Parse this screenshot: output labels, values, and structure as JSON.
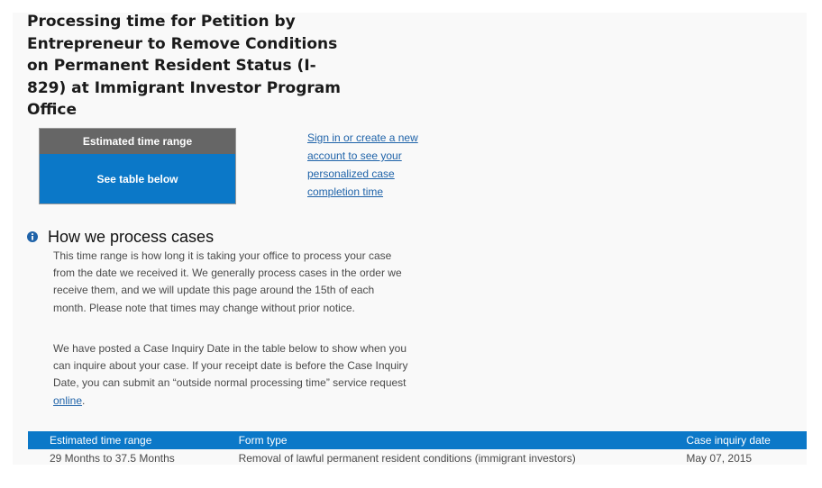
{
  "title": "Processing time for Petition by Entrepreneur to Remove Conditions on Permanent Resident Status (I-829) at Immigrant Investor Program Office",
  "estimate_box": {
    "header": "Estimated time range",
    "value": "See table below"
  },
  "signin_link": "Sign in or create a new account to see your personalized case completion time",
  "how_section": {
    "icon": "info-icon",
    "heading": "How we process cases",
    "paragraph_1": "This time range is how long it is taking your office to process your case from the date we received it. We generally process cases in the order we receive them, and we will update this page around the 15th of each month. Please note that times may change without prior notice.",
    "paragraph_2_text": "We have posted a Case Inquiry Date in the table below to show when you can inquire about your case. If your receipt date is before the Case Inquiry Date, you can submit an “outside normal processing time” service request ",
    "paragraph_2_link": "online",
    "paragraph_2_end": "."
  },
  "table": {
    "headers": [
      "Estimated time range",
      "Form type",
      "Case inquiry date"
    ],
    "rows": [
      [
        "29 Months to 37.5 Months",
        "Removal of lawful permanent resident conditions (immigrant investors)",
        "May 07, 2015"
      ]
    ]
  },
  "colors": {
    "accent_blue": "#0b78c8",
    "header_gray": "#666666",
    "link_blue": "#1f63a9"
  }
}
